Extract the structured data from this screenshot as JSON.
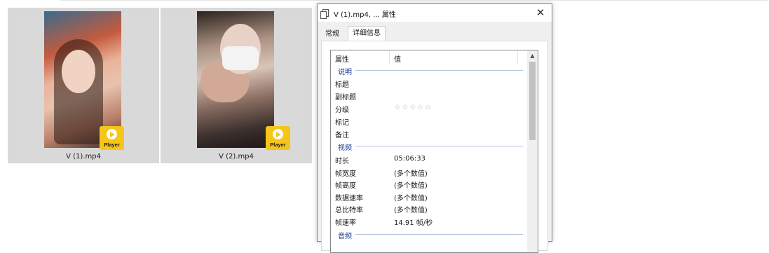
{
  "explorer": {
    "files": [
      {
        "name": "V (1).mp4",
        "badge": "Player"
      },
      {
        "name": "V (2).mp4",
        "badge": "Player"
      }
    ]
  },
  "dialog": {
    "title": "V (1).mp4, ... 属性",
    "close_glyph": "✕",
    "tabs": [
      "常规",
      "详细信息"
    ],
    "active_tab": "详细信息",
    "columns": {
      "property": "属性",
      "value": "值"
    },
    "scroll_up_glyph": "▲",
    "groups": {
      "description": "说明",
      "video": "视频",
      "audio": "音频"
    },
    "description_rows": [
      {
        "key": "标题",
        "value": ""
      },
      {
        "key": "副标题",
        "value": ""
      },
      {
        "key": "分级",
        "value": "☆☆☆☆☆"
      },
      {
        "key": "标记",
        "value": ""
      },
      {
        "key": "备注",
        "value": ""
      }
    ],
    "video_rows": [
      {
        "key": "时长",
        "value": "05:06:33"
      },
      {
        "key": "帧宽度",
        "value": "(多个数值)"
      },
      {
        "key": "帧高度",
        "value": "(多个数值)"
      },
      {
        "key": "数据速率",
        "value": "(多个数值)"
      },
      {
        "key": "总比特率",
        "value": "(多个数值)"
      },
      {
        "key": "帧速率",
        "value": "14.91 帧/秒"
      }
    ]
  }
}
